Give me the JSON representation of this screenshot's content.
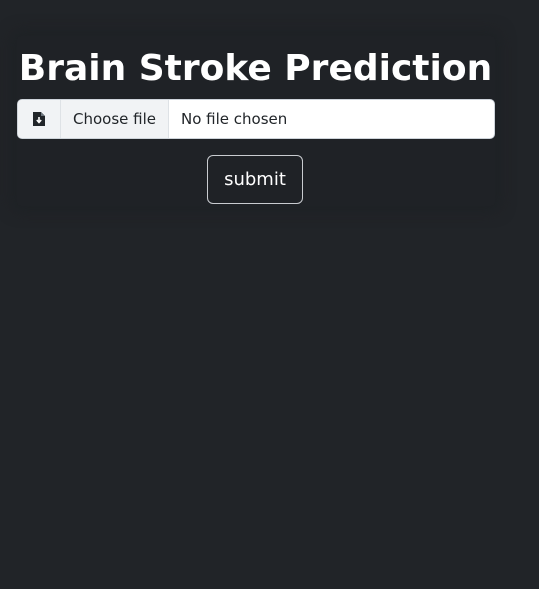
{
  "page": {
    "title": "Brain Stroke Prediction"
  },
  "file_input": {
    "icon": "file-download-icon",
    "choose_label": "Choose file",
    "status_text": "No file chosen"
  },
  "form": {
    "submit_label": "submit"
  },
  "colors": {
    "background": "#212428",
    "title_text": "#ffffff",
    "input_background": "#ffffff",
    "button_border": "#c9ccd0"
  }
}
